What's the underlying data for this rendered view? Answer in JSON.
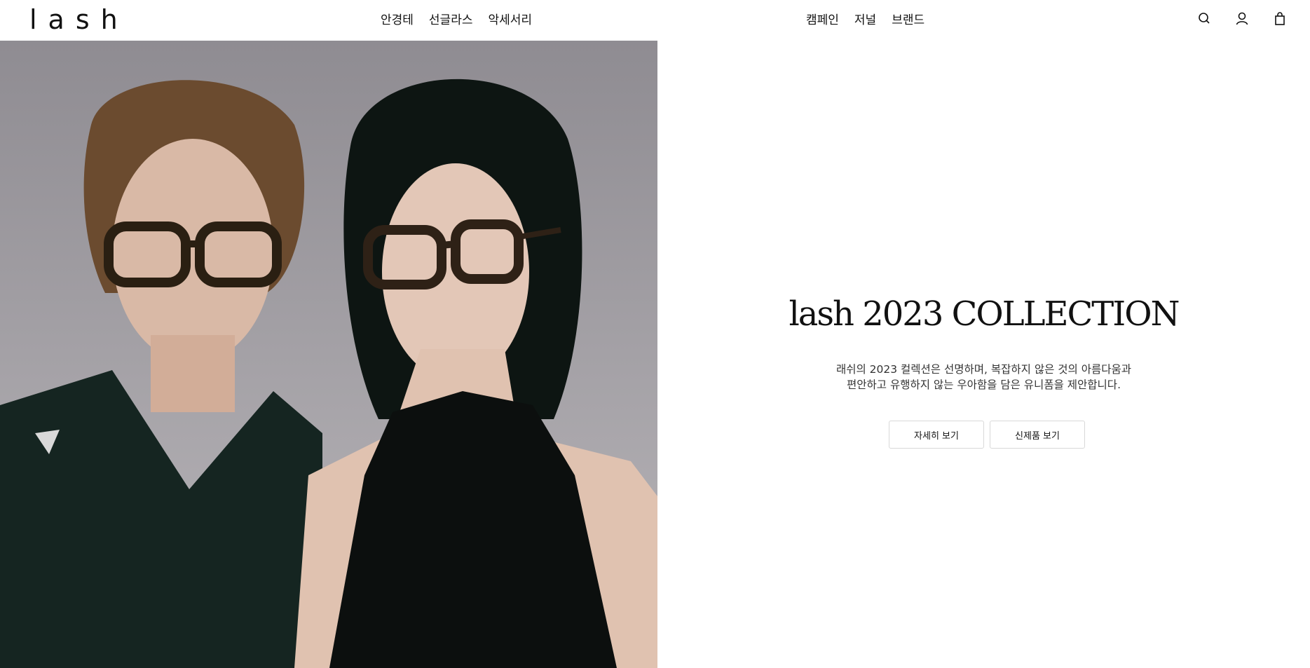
{
  "brand": {
    "logo": "lash"
  },
  "nav": {
    "left": [
      "안경테",
      "선글라스",
      "악세서리"
    ],
    "right": [
      "캠페인",
      "저널",
      "브랜드"
    ]
  },
  "header_icons": [
    "search-icon",
    "account-icon",
    "shopping-bag-icon"
  ],
  "hero": {
    "title": "lash 2023 COLLECTION",
    "description_line1": "래쉬의 2023 컬렉션은 선명하며, 복잡하지 않은 것의 아름다움과",
    "description_line2": "편안하고 유행하지 않는 우아함을 담은 유니폼을 제안합니다.",
    "button_details": "자세히 보기",
    "button_new": "신제품 보기"
  }
}
